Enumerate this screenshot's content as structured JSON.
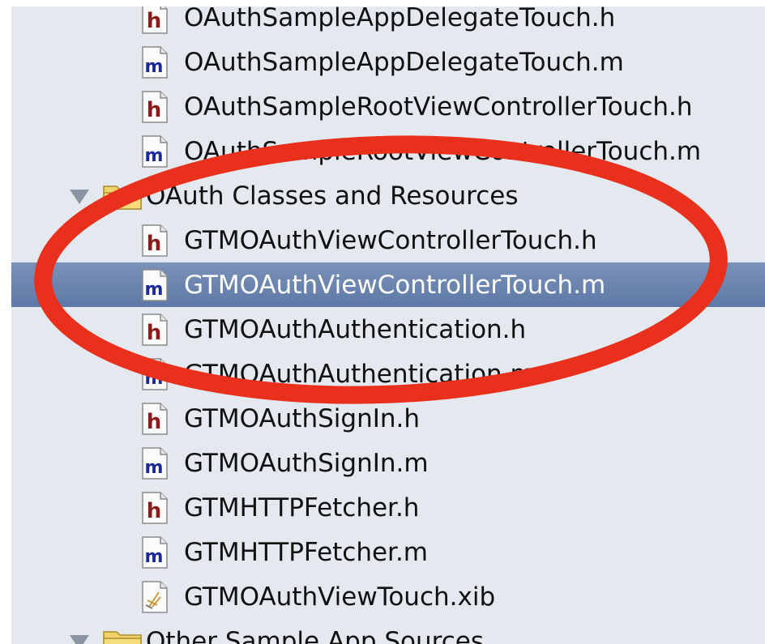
{
  "colors": {
    "panel_background": "#e4e9ef",
    "selection": "#6a84b0",
    "header_letter": "#8b1a1a",
    "impl_letter": "#1a2a9b",
    "annotation": "#e8301c"
  },
  "outline": {
    "rows": [
      {
        "kind": "file",
        "icon": "header-file-icon",
        "name": "OAuthSampleAppDelegateTouch.h"
      },
      {
        "kind": "file",
        "icon": "implementation-file-icon",
        "name": "OAuthSampleAppDelegateTouch.m"
      },
      {
        "kind": "file",
        "icon": "header-file-icon",
        "name": "OAuthSampleRootViewControllerTouch.h"
      },
      {
        "kind": "file",
        "icon": "implementation-file-icon",
        "name": "OAuthSampleRootViewControllerTouch.m"
      },
      {
        "kind": "group",
        "icon": "folder-icon",
        "name": "OAuth Classes and Resources"
      },
      {
        "kind": "file",
        "icon": "header-file-icon",
        "name": "GTMOAuthViewControllerTouch.h"
      },
      {
        "kind": "file",
        "icon": "implementation-file-icon",
        "name": "GTMOAuthViewControllerTouch.m",
        "selected": true
      },
      {
        "kind": "file",
        "icon": "header-file-icon",
        "name": "GTMOAuthAuthentication.h"
      },
      {
        "kind": "file",
        "icon": "implementation-file-icon",
        "name": "GTMOAuthAuthentication.m"
      },
      {
        "kind": "file",
        "icon": "header-file-icon",
        "name": "GTMOAuthSignIn.h"
      },
      {
        "kind": "file",
        "icon": "implementation-file-icon",
        "name": "GTMOAuthSignIn.m"
      },
      {
        "kind": "file",
        "icon": "header-file-icon",
        "name": "GTMHTTPFetcher.h"
      },
      {
        "kind": "file",
        "icon": "implementation-file-icon",
        "name": "GTMHTTPFetcher.m"
      },
      {
        "kind": "file",
        "icon": "xib-file-icon",
        "name": "GTMOAuthViewTouch.xib"
      },
      {
        "kind": "group",
        "icon": "folder-icon",
        "name": "Other Sample App Sources"
      }
    ]
  },
  "icon_glyphs": {
    "header": "h",
    "implementation": "m"
  }
}
